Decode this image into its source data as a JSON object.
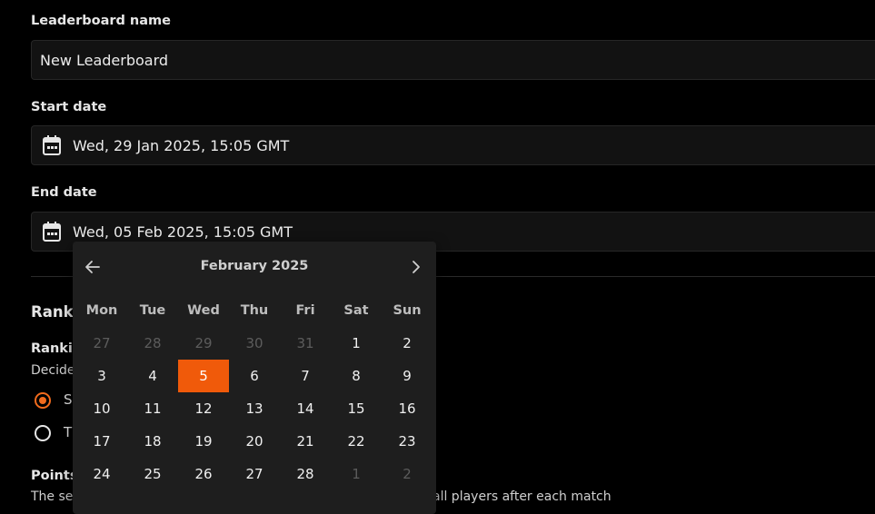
{
  "form": {
    "name_label": "Leaderboard name",
    "name_value": "New Leaderboard",
    "start_label": "Start date",
    "start_value": "Wed, 29 Jan 2025, 15:05 GMT",
    "end_label": "End date",
    "end_value": "Wed, 05 Feb 2025, 15:05 GMT"
  },
  "ranking": {
    "section_title": "Ranki",
    "sub_title": "Ranki",
    "description": "Decide",
    "options": [
      {
        "label": "S",
        "checked": true
      },
      {
        "label": "T",
        "checked": false
      }
    ]
  },
  "points": {
    "title": "Points",
    "description_left": "The se",
    "description_right": "all players after each match"
  },
  "calendar": {
    "month_label": "February 2025",
    "weekdays": [
      "Mon",
      "Tue",
      "Wed",
      "Thu",
      "Fri",
      "Sat",
      "Sun"
    ],
    "days": [
      {
        "d": "27",
        "muted": true
      },
      {
        "d": "28",
        "muted": true
      },
      {
        "d": "29",
        "muted": true
      },
      {
        "d": "30",
        "muted": true
      },
      {
        "d": "31",
        "muted": true
      },
      {
        "d": "1"
      },
      {
        "d": "2"
      },
      {
        "d": "3"
      },
      {
        "d": "4"
      },
      {
        "d": "5",
        "selected": true
      },
      {
        "d": "6"
      },
      {
        "d": "7"
      },
      {
        "d": "8"
      },
      {
        "d": "9"
      },
      {
        "d": "10"
      },
      {
        "d": "11"
      },
      {
        "d": "12"
      },
      {
        "d": "13"
      },
      {
        "d": "14"
      },
      {
        "d": "15"
      },
      {
        "d": "16"
      },
      {
        "d": "17"
      },
      {
        "d": "18"
      },
      {
        "d": "19"
      },
      {
        "d": "20"
      },
      {
        "d": "21"
      },
      {
        "d": "22"
      },
      {
        "d": "23"
      },
      {
        "d": "24"
      },
      {
        "d": "25"
      },
      {
        "d": "26"
      },
      {
        "d": "27"
      },
      {
        "d": "28"
      },
      {
        "d": "1",
        "muted": true
      },
      {
        "d": "2",
        "muted": true
      }
    ]
  },
  "colors": {
    "accent": "#f05a0a",
    "background": "#000000",
    "field": "#121212",
    "popover": "#1e1e1e"
  },
  "icons": {
    "calendar": "calendar-icon",
    "prev": "arrow-left-icon",
    "next": "chevron-right-icon"
  }
}
